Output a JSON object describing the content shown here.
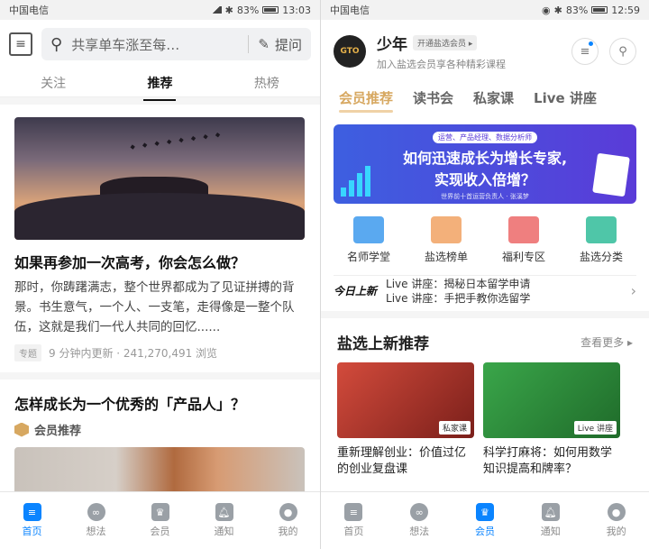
{
  "left": {
    "status": {
      "carrier": "中国电信",
      "battery": "83%",
      "time": "13:03"
    },
    "search": {
      "query": "共享单车涨至每…",
      "ask_label": "提问"
    },
    "tabs": [
      {
        "label": "关注"
      },
      {
        "label": "推荐"
      },
      {
        "label": "热榜"
      }
    ],
    "feed": [
      {
        "title": "如果再参加一次高考，你会怎么做？",
        "body": "那时，你踌躇满志，整个世界都成为了见证拼搏的背景。书生意气，一个人、一支笔，走得像是一整个队伍，这就是我们一代人共同的回忆......",
        "tag": "专题",
        "meta": "9 分钟内更新 · 241,270,491 浏览"
      },
      {
        "title": "怎样成长为一个优秀的「产品人」？",
        "member_label": "会员推荐"
      }
    ],
    "nav": [
      {
        "label": "首页"
      },
      {
        "label": "想法"
      },
      {
        "label": "会员"
      },
      {
        "label": "通知"
      },
      {
        "label": "我的"
      }
    ]
  },
  "right": {
    "status": {
      "carrier": "中国电信",
      "battery": "83%",
      "time": "12:59"
    },
    "profile": {
      "name": "少年",
      "vip_button": "开通盐选会员 ▸",
      "subtitle": "加入盐选会员享各种精彩课程"
    },
    "tabs": [
      {
        "label": "会员推荐"
      },
      {
        "label": "读书会"
      },
      {
        "label": "私家课"
      },
      {
        "label": "Live 讲座"
      }
    ],
    "banner": {
      "subtitle": "运营、产品经理、数据分析师",
      "line1": "如何迅速成长为增长专家,",
      "line2": "实现收入倍增？",
      "footer": "世界前十首运营负责人 · 张溪梦"
    },
    "categories": [
      {
        "label": "名师学堂",
        "color": "#5aa9f0"
      },
      {
        "label": "盐选榜单",
        "color": "#f3b07a"
      },
      {
        "label": "福利专区",
        "color": "#ef7f7f"
      },
      {
        "label": "盐选分类",
        "color": "#4fc6a8"
      }
    ],
    "ticker": {
      "logo": "今日上新",
      "items": [
        "Live 讲座：揭秘日本留学申请",
        "Live 讲座：手把手教你选留学"
      ]
    },
    "section": {
      "title": "盐选上新推荐",
      "more": "查看更多 ▸"
    },
    "courses": [
      {
        "title": "重新理解创业：价值过亿的创业复盘课",
        "label": "私家课",
        "color": "#d34b3c"
      },
      {
        "title": "科学打麻将：如何用数学知识提高和牌率？",
        "label": "Live 讲座",
        "color": "#3aa64a"
      }
    ],
    "nav": [
      {
        "label": "首页"
      },
      {
        "label": "想法"
      },
      {
        "label": "会员"
      },
      {
        "label": "通知"
      },
      {
        "label": "我的"
      }
    ]
  }
}
